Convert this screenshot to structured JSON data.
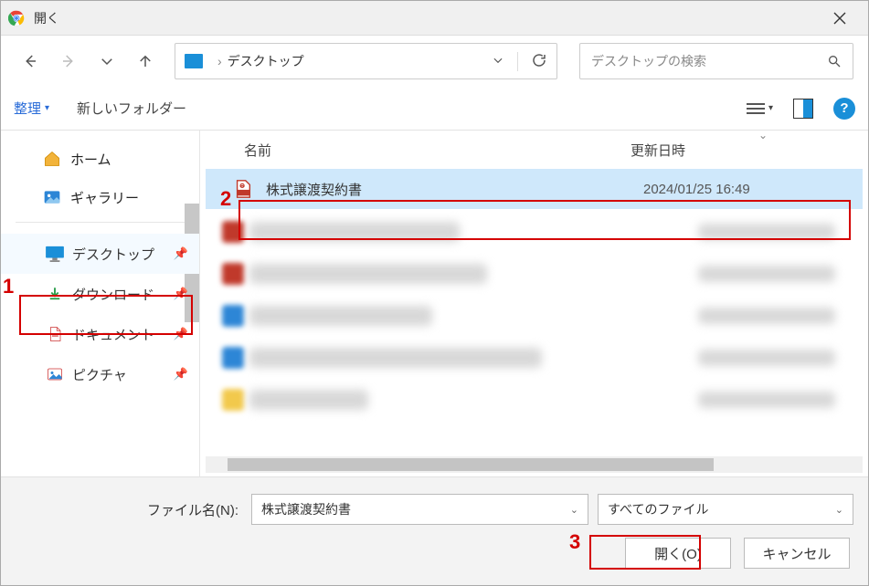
{
  "title": "開く",
  "address": {
    "location": "デスクトップ"
  },
  "search": {
    "placeholder": "デスクトップの検索"
  },
  "cmdbar": {
    "organize": "整理",
    "new_folder": "新しいフォルダー"
  },
  "sidebar": {
    "home": "ホーム",
    "gallery": "ギャラリー",
    "desktop": "デスクトップ",
    "downloads": "ダウンロード",
    "documents": "ドキュメント",
    "pictures": "ピクチャ"
  },
  "columns": {
    "name": "名前",
    "modified": "更新日時"
  },
  "file": {
    "name": "株式譲渡契約書",
    "date": "2024/01/25 16:49"
  },
  "footer": {
    "filename_label": "ファイル名(N):",
    "filename_value": "株式譲渡契約書",
    "filter": "すべてのファイル",
    "open": "開く(O)",
    "cancel": "キャンセル"
  },
  "annotations": {
    "a1": "1",
    "a2": "2",
    "a3": "3"
  }
}
